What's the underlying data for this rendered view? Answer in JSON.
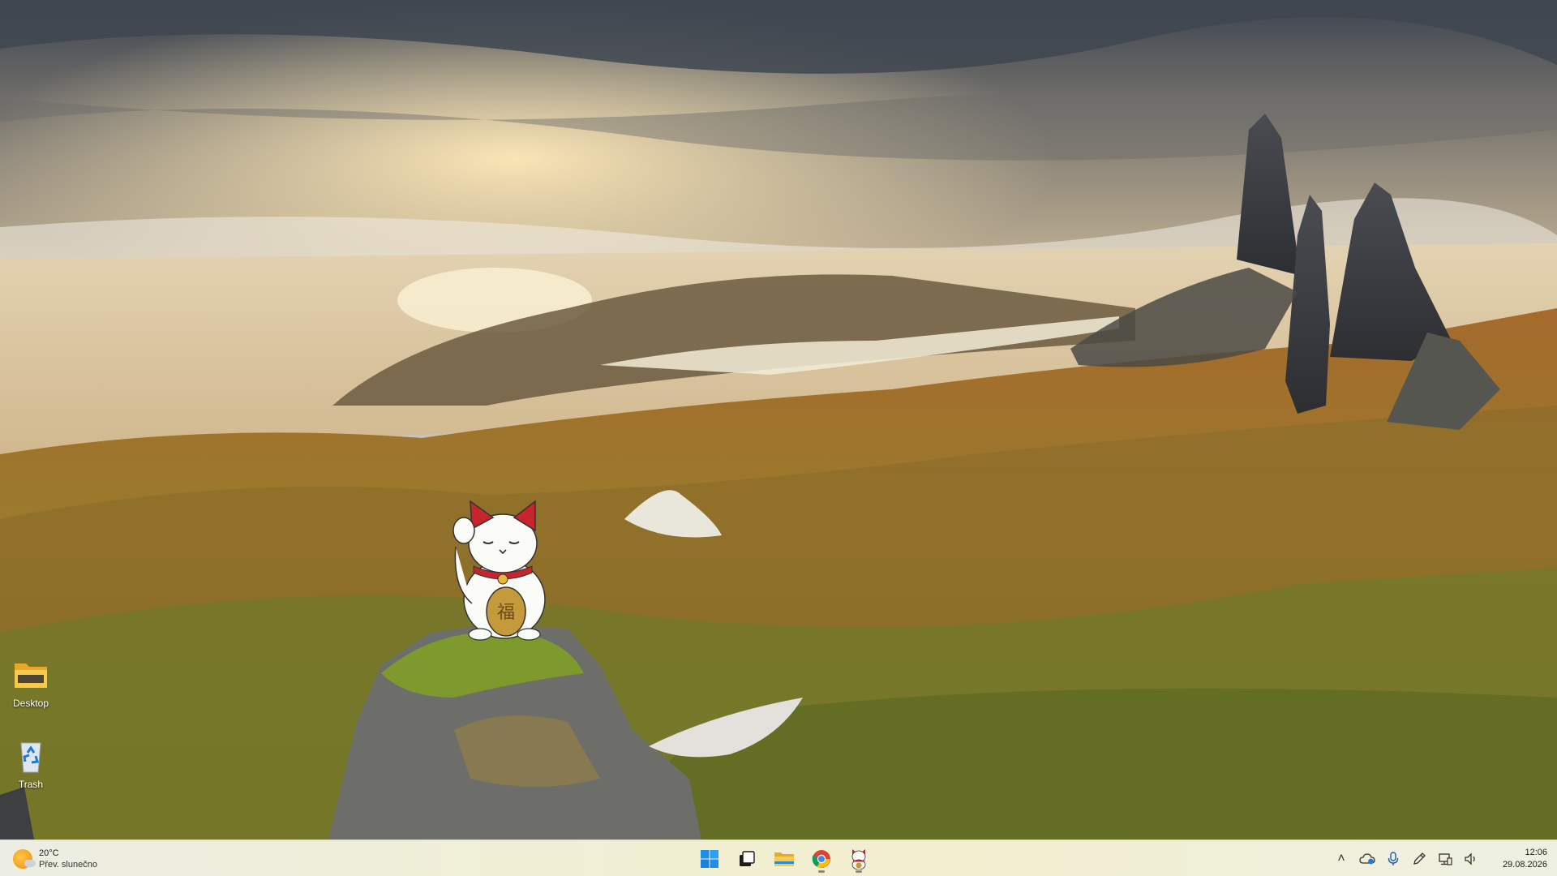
{
  "desktop": {
    "icons": [
      {
        "label": "Desktop",
        "icon": "folder-icon"
      },
      {
        "label": "Trash",
        "icon": "recycle-bin-icon"
      }
    ],
    "mascot": "maneki-neko-icon"
  },
  "taskbar": {
    "weather": {
      "temperature": "20°C",
      "condition": "Přev. slunečno",
      "icon": "partly-sunny-icon"
    },
    "apps": [
      {
        "name": "start",
        "icon": "windows-start-icon"
      },
      {
        "name": "task-view",
        "icon": "task-view-icon"
      },
      {
        "name": "file-explorer",
        "icon": "folder-icon"
      },
      {
        "name": "chrome",
        "icon": "chrome-icon"
      },
      {
        "name": "cat-app",
        "icon": "maneki-neko-icon"
      }
    ],
    "tray": [
      {
        "name": "show-hidden",
        "icon": "chevron-up-icon",
        "glyph": "˄"
      },
      {
        "name": "onedrive",
        "icon": "cloud-icon"
      },
      {
        "name": "microphone",
        "icon": "microphone-icon"
      },
      {
        "name": "pen",
        "icon": "pen-icon"
      },
      {
        "name": "network",
        "icon": "network-icon"
      },
      {
        "name": "volume",
        "icon": "volume-icon"
      }
    ],
    "clock": {
      "time": "12:06",
      "date": "29.08.2026"
    }
  }
}
